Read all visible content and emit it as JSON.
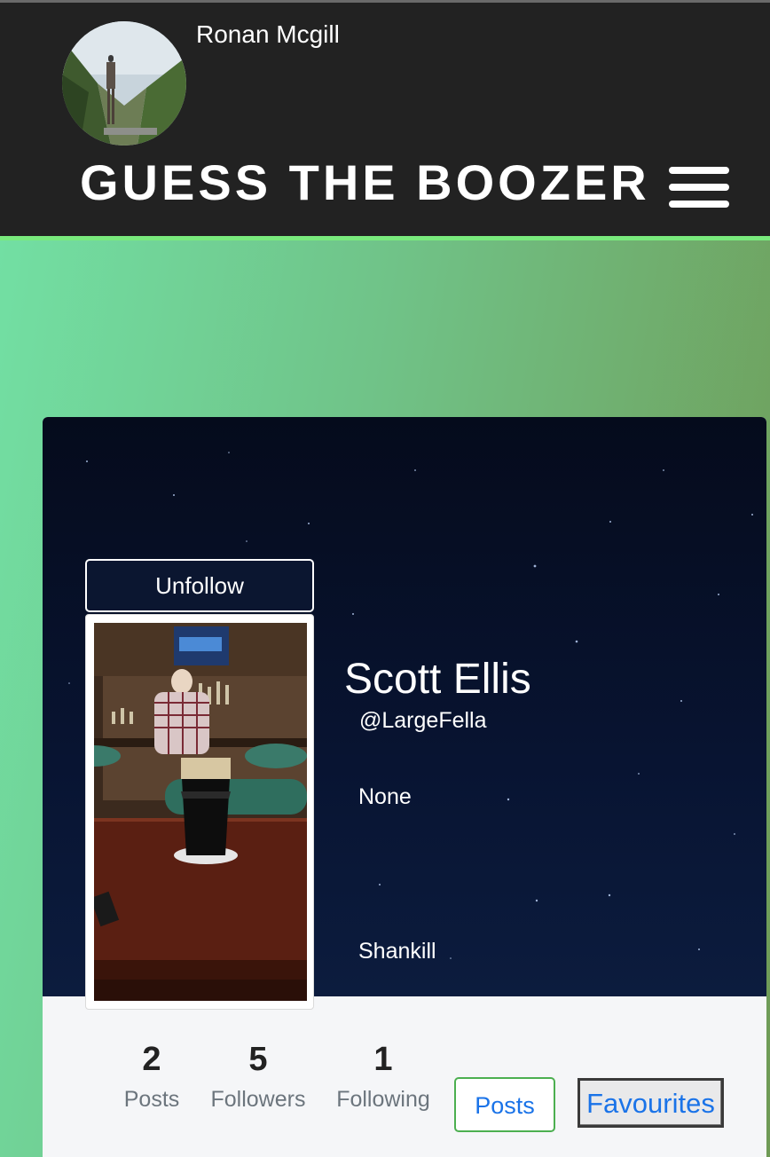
{
  "header": {
    "username": "Ronan Mcgill",
    "brand": "GUESS THE BOOZER",
    "accent_color": "#79ea7d"
  },
  "profile": {
    "follow_label": "Unfollow",
    "name": "Scott Ellis",
    "handle": "@LargeFella",
    "bio": "None",
    "location": "Shankill"
  },
  "stats": {
    "posts": {
      "value": "2",
      "label": "Posts"
    },
    "followers": {
      "value": "5",
      "label": "Followers"
    },
    "following": {
      "value": "1",
      "label": "Following"
    }
  },
  "tabs": {
    "posts_label": "Posts",
    "favourites_label": "Favourites"
  }
}
